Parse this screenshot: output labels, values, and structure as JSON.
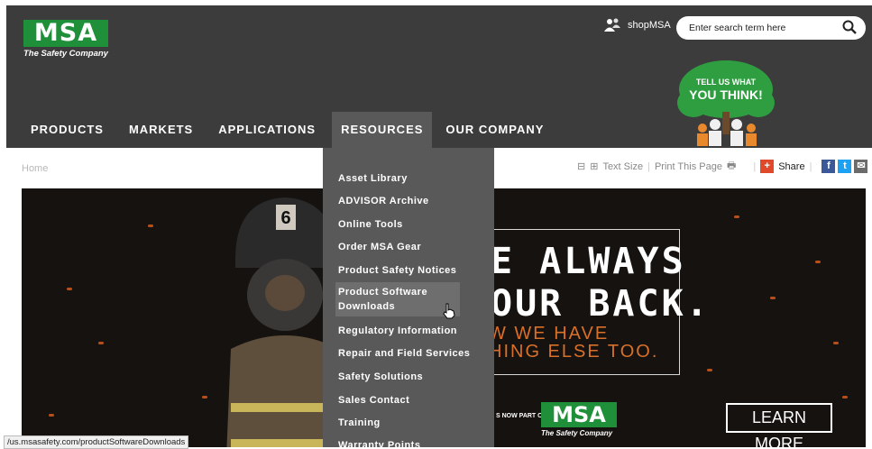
{
  "header": {
    "logo_text": "MSA",
    "logo_tagline": "The Safety Company",
    "shop_label": "shopMSA",
    "search_placeholder": "Enter search term here",
    "feedback_line1": "TELL US WHAT",
    "feedback_line2": "YOU THINK!"
  },
  "nav": {
    "items": [
      {
        "label": "PRODUCTS"
      },
      {
        "label": "MARKETS"
      },
      {
        "label": "APPLICATIONS"
      },
      {
        "label": "RESOURCES"
      },
      {
        "label": "OUR COMPANY"
      }
    ]
  },
  "dropdown": {
    "items": [
      "Asset Library",
      "ADVISOR Archive",
      "Online Tools",
      "Order MSA Gear",
      "Product Safety Notices",
      "Product Software Downloads",
      "Regulatory Information",
      "Repair and Field Services",
      "Safety Solutions",
      "Sales Contact",
      "Training",
      "Warranty Points"
    ],
    "hovered": "Product Software Downloads"
  },
  "breadcrumb": {
    "home": "Home"
  },
  "tools": {
    "text_size": "Text Size",
    "sep": "|",
    "print": "Print This Page",
    "share": "Share"
  },
  "hero": {
    "helmet_number": "6",
    "line1": "E ALWAYS",
    "line2": "OUR BACK.",
    "line3": "W WE HAVE",
    "line4": "HING ELSE TOO.",
    "now_part": "S NOW PART OF",
    "logo_text": "MSA",
    "logo_tagline": "The Safety Company",
    "cta": "LEARN MORE"
  },
  "status_bar": {
    "url": "/us.msasafety.com/productSoftwareDownloads"
  },
  "colors": {
    "brand_green": "#1f8f3a",
    "header_bg": "#3c3c3c",
    "dropdown_bg": "#595959",
    "accent_orange": "#d8702a"
  }
}
